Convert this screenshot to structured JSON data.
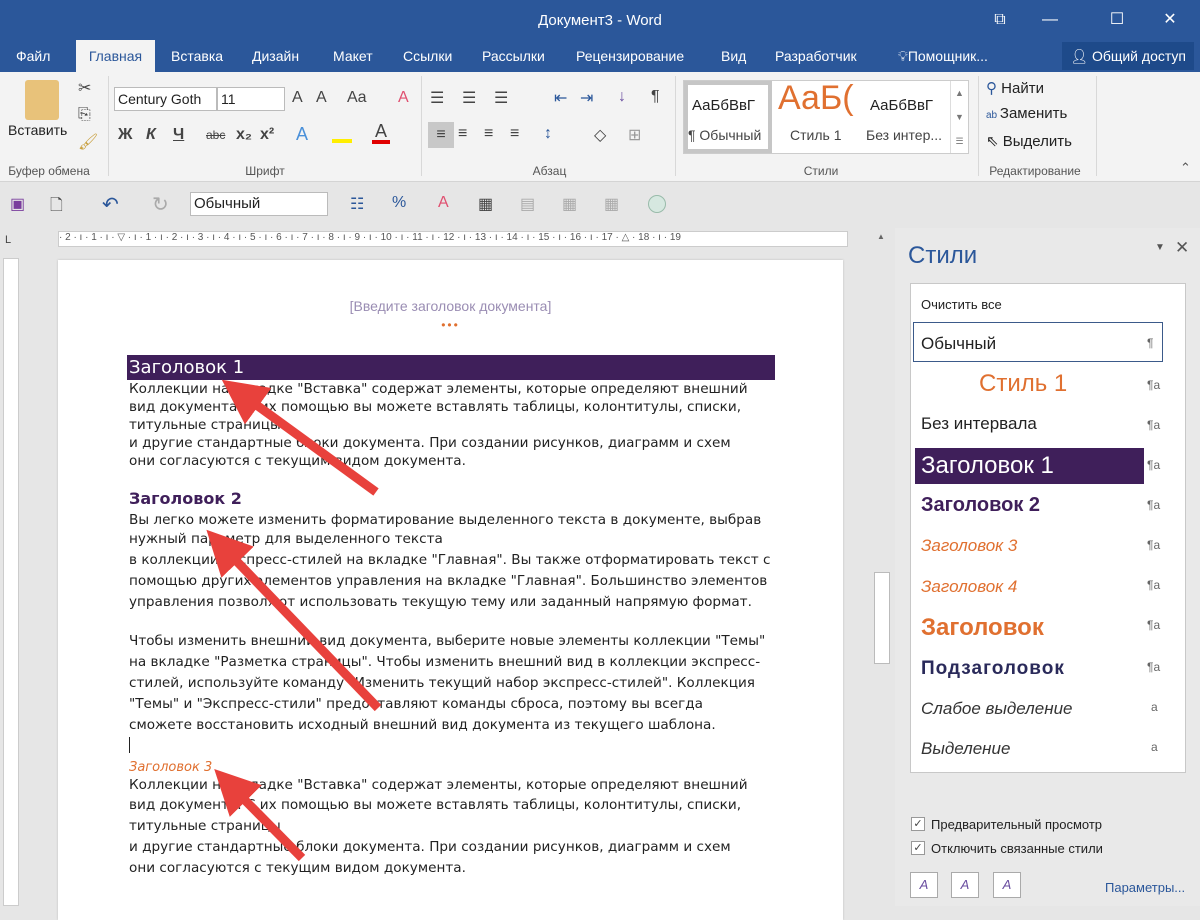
{
  "window": {
    "title": "Документ3 - Word",
    "controls": [
      "⧉",
      "—",
      "☐",
      "✕"
    ]
  },
  "tabs": [
    "Файл",
    "Главная",
    "Вставка",
    "Дизайн",
    "Макет",
    "Ссылки",
    "Рассылки",
    "Рецензирование",
    "Вид",
    "Разработчик",
    "Помощник..."
  ],
  "active_tab": "Главная",
  "share": "Общий доступ",
  "ribbon": {
    "clipboard": {
      "paste": "Вставить",
      "label": "Буфер обмена"
    },
    "font": {
      "name": "Century Goth",
      "size": "11",
      "label": "Шрифт",
      "bold": "Ж",
      "italic": "К",
      "underline": "Ч",
      "strike": "abc",
      "sub": "x₂",
      "sup": "x²",
      "case": "Aa"
    },
    "paragraph": {
      "label": "Абзац"
    },
    "styles": {
      "label": "Стили",
      "gallery": [
        {
          "preview": "АаБбВвГ",
          "name": "¶ Обычный"
        },
        {
          "preview": "АаБ(",
          "name": "Стиль 1"
        },
        {
          "preview": "АаБбВвГ",
          "name": "Без интер..."
        }
      ]
    },
    "editing": {
      "label": "Редактирование",
      "find": "Найти",
      "replace": "Заменить",
      "select": "Выделить"
    }
  },
  "qat": {
    "style_combo": "Обычный"
  },
  "ruler": {
    "text": "· 2 · ı · 1 · ı · ▽ · ı · 1 · ı · 2 · ı · 3 · ı · 4 · ı · 5 · ı · 6 · ı · 7 · ı · 8 · ı · 9 · ı · 10 · ı · 11 · ı · 12 · ı · 13 · ı · 14 · ı · 15 · ı · 16 · ı · 17 · △ · 18 · ı · 19"
  },
  "document": {
    "header_placeholder": "[Введите заголовок документа]",
    "h1": "Заголовок 1",
    "p1": [
      "Коллекции на вкладке \"Вставка\" содержат элементы, которые определяют внешний",
      "вид документа. С их помощью вы можете вставлять таблицы, колонтитулы, списки,",
      "титульные страницы",
      "и другие стандартные блоки документа. При создании рисунков, диаграмм и схем",
      "они согласуются с текущим видом документа."
    ],
    "h2": "Заголовок 2",
    "p2": [
      "Вы легко можете изменить форматирование выделенного текста в документе, выбрав",
      "нужный параметр для выделенного текста",
      "в коллекции экспресс-стилей на вкладке \"Главная\". Вы также отформатировать текст с",
      "помощью других элементов управления на вкладке \"Главная\". Большинство элементов",
      "управления позволяют использовать текущую тему или заданный напрямую формат."
    ],
    "p3": [
      "Чтобы изменить внешний вид документа, выберите новые элементы коллекции \"Темы\"",
      "на вкладке \"Разметка страницы\". Чтобы изменить внешний вид в коллекции экспресс-",
      "стилей, используйте команду \"Изменить текущий набор экспресс-стилей\". Коллекция",
      "\"Темы\" и \"Экспресс-стили\" предоставляют команды сброса, поэтому вы всегда",
      "сможете восстановить исходный внешний вид документа из текущего шаблона."
    ],
    "h3": "Заголовок 3",
    "p4": [
      "Коллекции на вкладке \"Вставка\" содержат элементы, которые определяют внешний",
      "вид документа. С их помощью вы можете вставлять таблицы, колонтитулы, списки,",
      "титульные страницы",
      "и другие стандартные блоки документа. При создании рисунков, диаграмм и схем",
      "они согласуются с текущим видом документа."
    ]
  },
  "styles_pane": {
    "title": "Стили",
    "clear_all": "Очистить все",
    "items": [
      {
        "name": "Обычный",
        "mark": "¶"
      },
      {
        "name": "Стиль 1",
        "mark": "¶a"
      },
      {
        "name": "Без интервала",
        "mark": "¶a"
      },
      {
        "name": "Заголовок 1",
        "mark": "¶a"
      },
      {
        "name": "Заголовок 2",
        "mark": "¶a"
      },
      {
        "name": "Заголовок 3",
        "mark": "¶a"
      },
      {
        "name": "Заголовок 4",
        "mark": "¶a"
      },
      {
        "name": "Заголовок",
        "mark": "¶a"
      },
      {
        "name": "Подзаголовок",
        "mark": "¶a"
      },
      {
        "name": "Слабое выделение",
        "mark": "a"
      },
      {
        "name": "Выделение",
        "mark": "a"
      }
    ],
    "preview_label": "Предварительный просмотр",
    "preview_checked": true,
    "linked_label": "Отключить связанные стили",
    "linked_checked": true,
    "options": "Параметры..."
  },
  "colors": {
    "brand": "#2b579a",
    "heading_purple": "#3f1f5a",
    "accent_orange": "#e07030",
    "arrow": "#e8413c"
  }
}
